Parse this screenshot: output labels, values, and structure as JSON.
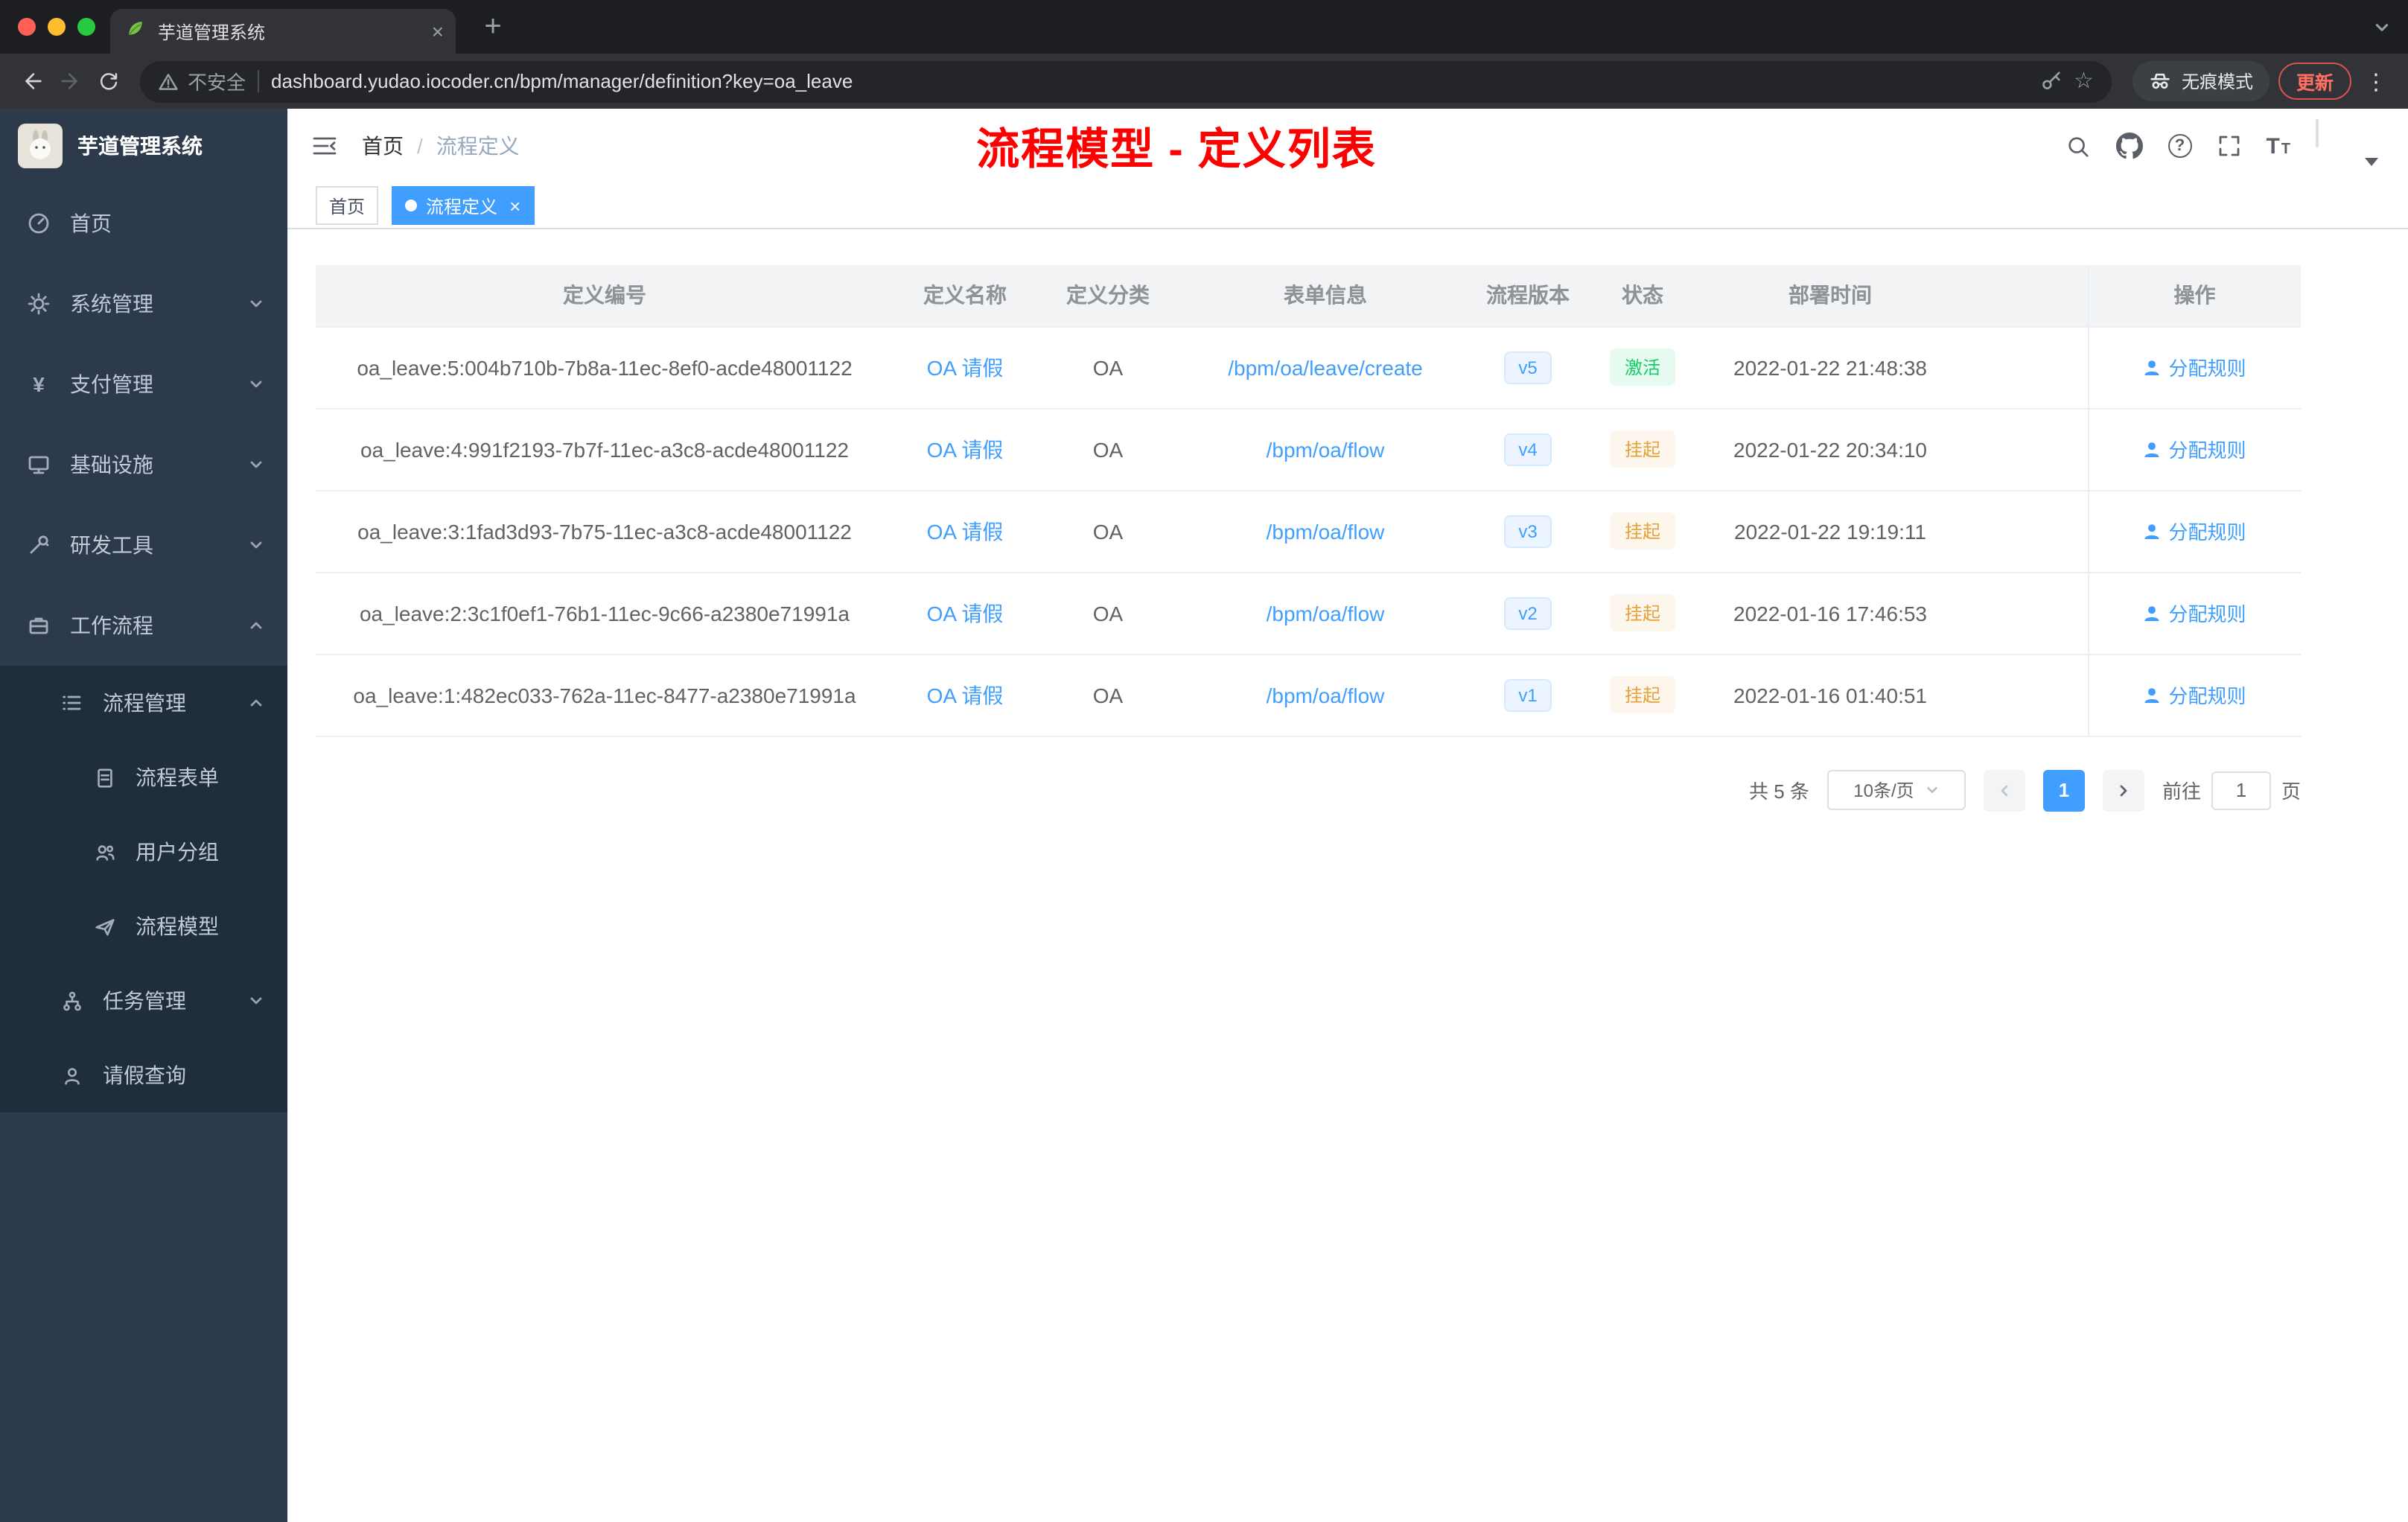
{
  "colors": {
    "accent": "#409eff",
    "success": "#13ce66",
    "warning": "#e6a23c",
    "annotation": "#ff0000",
    "sidebar_bg": "#2d3a4b",
    "submenu_bg": "#1f2d3d"
  },
  "browser": {
    "tab": {
      "title": "芋道管理系统"
    },
    "toolbar": {
      "security_label": "不安全",
      "url": "dashboard.yudao.iocoder.cn/bpm/manager/definition?key=oa_leave",
      "incognito_label": "无痕模式",
      "update_label": "更新"
    }
  },
  "sidebar": {
    "logo_title": "芋道管理系统",
    "items": [
      {
        "label": "首页"
      },
      {
        "label": "系统管理"
      },
      {
        "label": "支付管理"
      },
      {
        "label": "基础设施"
      },
      {
        "label": "研发工具"
      },
      {
        "label": "工作流程"
      }
    ],
    "submenu": [
      {
        "label": "流程管理"
      },
      {
        "label": "流程表单"
      },
      {
        "label": "用户分组"
      },
      {
        "label": "流程模型"
      },
      {
        "label": "任务管理"
      },
      {
        "label": "请假查询"
      }
    ]
  },
  "header": {
    "breadcrumb_home": "首页",
    "breadcrumb_sep": "/",
    "breadcrumb_current": "流程定义",
    "annotation": "流程模型 - 定义列表"
  },
  "tags": {
    "home": "首页",
    "current": "流程定义"
  },
  "table": {
    "columns": [
      "定义编号",
      "定义名称",
      "定义分类",
      "表单信息",
      "流程版本",
      "状态",
      "部署时间",
      "操作"
    ],
    "rows": [
      {
        "id": "oa_leave:5:004b710b-7b8a-11ec-8ef0-acde48001122",
        "name": "OA 请假",
        "category": "OA",
        "form": "/bpm/oa/leave/create",
        "version": "v5",
        "status": "激活",
        "time": "2022-01-22 21:48:38",
        "action": "分配规则"
      },
      {
        "id": "oa_leave:4:991f2193-7b7f-11ec-a3c8-acde48001122",
        "name": "OA 请假",
        "category": "OA",
        "form": "/bpm/oa/flow",
        "version": "v4",
        "status": "挂起",
        "time": "2022-01-22 20:34:10",
        "action": "分配规则"
      },
      {
        "id": "oa_leave:3:1fad3d93-7b75-11ec-a3c8-acde48001122",
        "name": "OA 请假",
        "category": "OA",
        "form": "/bpm/oa/flow",
        "version": "v3",
        "status": "挂起",
        "time": "2022-01-22 19:19:11",
        "action": "分配规则"
      },
      {
        "id": "oa_leave:2:3c1f0ef1-76b1-11ec-9c66-a2380e71991a",
        "name": "OA 请假",
        "category": "OA",
        "form": "/bpm/oa/flow",
        "version": "v2",
        "status": "挂起",
        "time": "2022-01-16 17:46:53",
        "action": "分配规则"
      },
      {
        "id": "oa_leave:1:482ec033-762a-11ec-8477-a2380e71991a",
        "name": "OA 请假",
        "category": "OA",
        "form": "/bpm/oa/flow",
        "version": "v1",
        "status": "挂起",
        "time": "2022-01-16 01:40:51",
        "action": "分配规则"
      }
    ]
  },
  "pagination": {
    "total": "共 5 条",
    "page_size": "10条/页",
    "page": "1",
    "goto_label": "前往",
    "goto_value": "1",
    "page_unit": "页"
  }
}
